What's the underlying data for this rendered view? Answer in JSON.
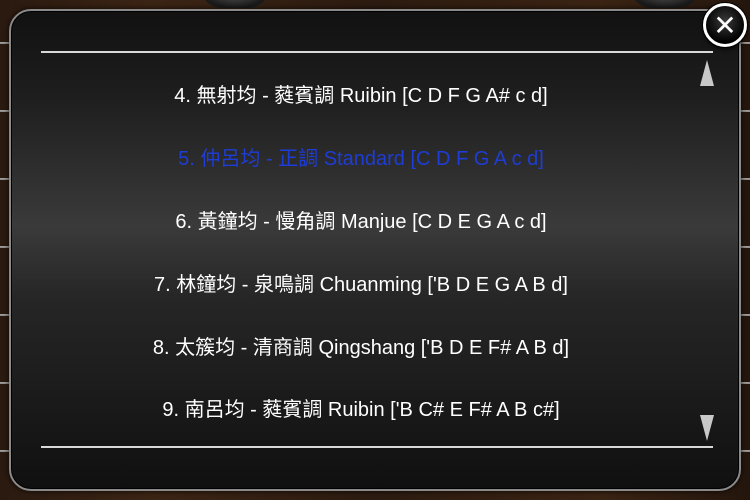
{
  "colors": {
    "text": "#ffffff",
    "selected_text": "#1e3cd6",
    "rule": "#d8d8d8"
  },
  "close_button": {
    "icon": "close-icon",
    "glyph": "✕"
  },
  "scroll": {
    "up_icon": "scroll-up-arrow-icon",
    "down_icon": "scroll-down-arrow-icon"
  },
  "tuning_list": {
    "selected_index": 1,
    "items": [
      {
        "label": "4. 無射均 - 蕤賓調 Ruibin [C D F G A# c d]"
      },
      {
        "label": "5. 仲呂均 - 正調 Standard [C D F G A c d]"
      },
      {
        "label": "6. 黃鐘均 - 慢角調 Manjue [C D E G A c d]"
      },
      {
        "label": "7. 林鐘均 - 泉鳴調 Chuanming ['B D E G A B d]"
      },
      {
        "label": "8. 太簇均 - 清商調 Qingshang ['B D E F# A B d]"
      },
      {
        "label": "9. 南呂均 - 蕤賓調 Ruibin ['B C# E F# A B c#]"
      }
    ]
  }
}
